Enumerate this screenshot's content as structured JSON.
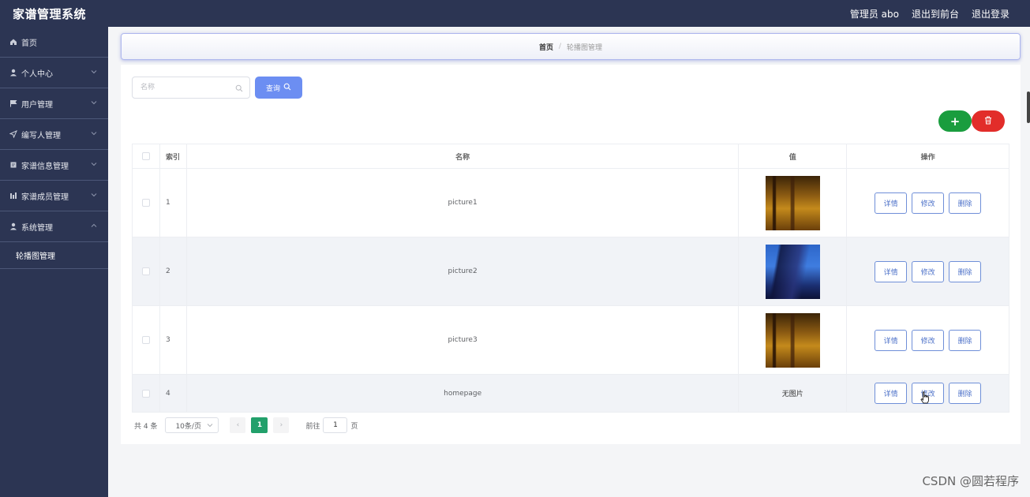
{
  "header": {
    "app_title": "家谱管理系统",
    "admin_label": "管理员 abo",
    "front_link": "退出到前台",
    "logout_link": "退出登录"
  },
  "sidebar": {
    "items": [
      {
        "label": "首页",
        "icon": "home-icon"
      },
      {
        "label": "个人中心",
        "icon": "user-icon"
      },
      {
        "label": "用户管理",
        "icon": "flag-icon"
      },
      {
        "label": "编写人管理",
        "icon": "send-icon"
      },
      {
        "label": "家谱信息管理",
        "icon": "document-icon"
      },
      {
        "label": "家谱成员管理",
        "icon": "bar-chart-icon"
      },
      {
        "label": "系统管理",
        "icon": "user-icon"
      }
    ],
    "sub_item": "轮播图管理"
  },
  "breadcrumb": {
    "home": "首页",
    "separator": "/",
    "current": "轮播图管理"
  },
  "search": {
    "placeholder": "名称",
    "button_label": "查询"
  },
  "actions": {
    "add_symbol": "+"
  },
  "table": {
    "headers": {
      "index": "索引",
      "name": "名称",
      "value": "值",
      "ops": "操作"
    },
    "rows": [
      {
        "index": "1",
        "name": "picture1",
        "value": "thumbnail"
      },
      {
        "index": "2",
        "name": "picture2",
        "value": "thumbnail"
      },
      {
        "index": "3",
        "name": "picture3",
        "value": "thumbnail"
      },
      {
        "index": "4",
        "name": "homepage",
        "value": "无图片"
      }
    ],
    "op_labels": {
      "detail": "详情",
      "edit": "修改",
      "delete": "删除"
    }
  },
  "pagination": {
    "total": "共 4 条",
    "page_size": "10条/页",
    "prev": "‹",
    "current_page": "1",
    "next": "›",
    "goto_label": "前往",
    "goto_value": "1",
    "page_suffix": "页"
  },
  "watermark": "CSDN @圆若程序",
  "colors": {
    "sidebar_bg": "#2c3553",
    "primary": "#6c8ef2",
    "add": "#1a9d3e",
    "delete": "#e22d2a",
    "pager_active": "#22a06b"
  }
}
